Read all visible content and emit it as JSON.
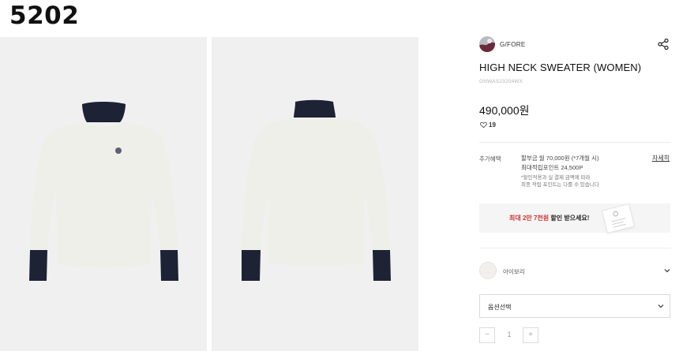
{
  "listing_number": "5202",
  "brand": {
    "name": "G/FORE",
    "logo_icon": "brand-logo-icon"
  },
  "product": {
    "title": "HIGH NECK SWEATER (WOMEN)",
    "code": "GNWAS23204WX",
    "price": "490,000원",
    "likes": "19"
  },
  "benefit": {
    "label": "추가혜택",
    "installment": "할부금 월 70,000원 (*7개월 시)",
    "max_points": "최대적립포인트 24,500P",
    "note_line1": "*할인적용과 실 결제 금액에 따라",
    "note_line2": "최종 적립 포인트는 다를 수 있습니다",
    "detail_link": "자세히"
  },
  "coupon": {
    "highlight": "최대 2만 7천원",
    "text": " 할인 받으세요!"
  },
  "color_option": {
    "name": "아이보리",
    "swatch_color": "#f1f0eb"
  },
  "option_select": {
    "placeholder": "옵션선택"
  },
  "quantity": {
    "value": "1",
    "minus_label": "−",
    "plus_label": "+"
  },
  "colors": {
    "sweater_body": "#efefe9",
    "collar_cuffs": "#1d2235",
    "page_bg": "#ffffff",
    "photo_bg": "#f0f0f0",
    "accent_red": "#d03434"
  },
  "icons": {
    "share": "share-icon",
    "heart": "heart-icon",
    "chevron": "chevron-down-icon"
  }
}
